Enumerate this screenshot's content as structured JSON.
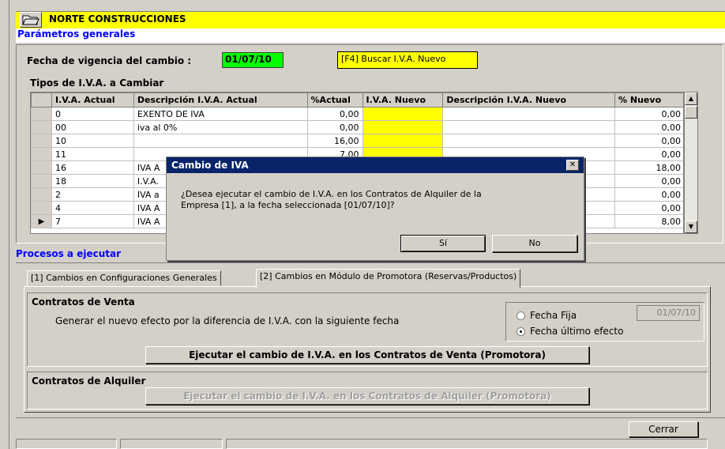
{
  "header": {
    "company": "NORTE CONSTRUCCIONES",
    "folder_icon": "folder-open-icon"
  },
  "params": {
    "title": "Parámetros generales",
    "fecha_label": "Fecha de vigencia del cambio :",
    "fecha_value": "01/07/10",
    "buscar_label": "[F4] Buscar I.V.A. Nuevo"
  },
  "grid": {
    "title": "Tipos de I.V.A. a Cambiar",
    "columns": [
      "I.V.A. Actual",
      "Descripción I.V.A. Actual",
      "%Actual",
      "I.V.A. Nuevo",
      "Descripción I.V.A. Nuevo",
      "% Nuevo"
    ],
    "rows": [
      {
        "ind": "",
        "actual": "0",
        "desc": "EXENTO DE IVA",
        "pct": "0,00",
        "nuevo": "",
        "desc_nuevo": "",
        "pct_nuevo": "0,00"
      },
      {
        "ind": "",
        "actual": "00",
        "desc": "iva al 0%",
        "pct": "0,00",
        "nuevo": "",
        "desc_nuevo": "",
        "pct_nuevo": "0,00"
      },
      {
        "ind": "",
        "actual": "10",
        "desc": "",
        "pct": "16,00",
        "nuevo": "",
        "desc_nuevo": "",
        "pct_nuevo": "0,00"
      },
      {
        "ind": "",
        "actual": "11",
        "desc": "",
        "pct": "7,00",
        "nuevo": "",
        "desc_nuevo": "",
        "pct_nuevo": "0,00"
      },
      {
        "ind": "",
        "actual": "16",
        "desc": "IVA A",
        "pct": "",
        "nuevo": "",
        "desc_nuevo": "",
        "pct_nuevo": "18,00"
      },
      {
        "ind": "",
        "actual": "18",
        "desc": "I.V.A.",
        "pct": "",
        "nuevo": "",
        "desc_nuevo": "",
        "pct_nuevo": "0,00"
      },
      {
        "ind": "",
        "actual": "2",
        "desc": "IVA a",
        "pct": "",
        "nuevo": "",
        "desc_nuevo": "",
        "pct_nuevo": "0,00"
      },
      {
        "ind": "",
        "actual": "4",
        "desc": "IVA A",
        "pct": "",
        "nuevo": "",
        "desc_nuevo": "",
        "pct_nuevo": "0,00"
      },
      {
        "ind": "▶",
        "actual": "7",
        "desc": "IVA A",
        "pct": "",
        "nuevo": "",
        "desc_nuevo": "",
        "pct_nuevo": "8,00"
      }
    ]
  },
  "procesos": {
    "title": "Procesos a ejecutar",
    "tabs": [
      "[1] Cambios en Configuraciones Generales",
      "[2] Cambios en Módulo de Promotora (Reservas/Productos)"
    ],
    "venta": {
      "title": "Contratos de Venta",
      "desc": "Generar el nuevo efecto por la diferencia de I.V.A. con la siguiente fecha",
      "radio_fija": "Fecha Fija",
      "radio_ultimo": "Fecha último efecto",
      "fecha_fija_value": "01/07/10",
      "button": "Ejecutar el cambio de I.V.A. en los Contratos de Venta (Promotora)"
    },
    "alquiler": {
      "title": "Contratos de Alquiler",
      "button": "Ejecutar el cambio de I.V.A. en los Contratos de Alquiler (Promotora)"
    }
  },
  "footer": {
    "cerrar": "Cerrar"
  },
  "dialog": {
    "title": "Cambio de IVA",
    "message_line1": "¿Desea ejecutar el cambio de I.V.A. en los Contratos de Alquiler de la",
    "message_line2": "Empresa [1], a la fecha seleccionada [01/07/10]?",
    "yes": "Sí",
    "no": "No",
    "close": "✕"
  },
  "colors": {
    "accent": "#0000ff",
    "highlight": "#ffff00",
    "date_bg": "#00ff00",
    "dialog_title": "#0a246a"
  }
}
